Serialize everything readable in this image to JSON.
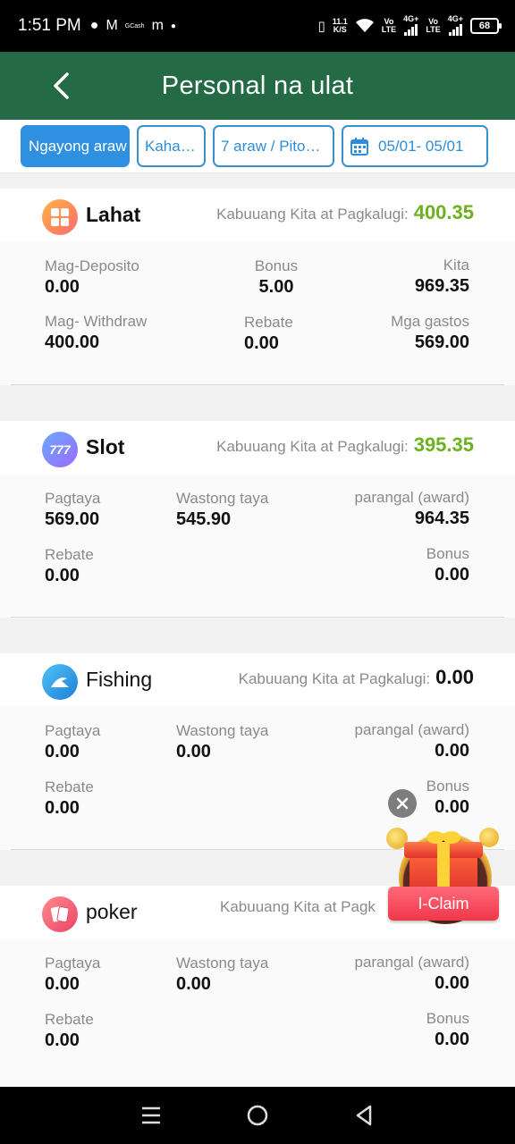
{
  "status_bar": {
    "time": "1:51 PM",
    "gcash_label": "GCash",
    "net_speed_value": "11.1",
    "net_speed_unit": "K/S",
    "volte1_top": "Vo",
    "volte1_bottom": "LTE",
    "net1": "4G+",
    "volte2_top": "Vo",
    "volte2_bottom": "LTE",
    "net2": "4G+",
    "battery": "68"
  },
  "header": {
    "title": "Personal na ulat"
  },
  "filters": {
    "today": "Ngayong araw",
    "yesterday": "Kaha…",
    "week": "7 araw / Pito…",
    "date_range": "05/01- 05/01"
  },
  "cards": {
    "all": {
      "name": "Lahat",
      "summary_label": "Kabuuang Kita at Pagkalugi:",
      "summary_value": "400.35",
      "deposit_label": "Mag-Deposito",
      "deposit_value": "0.00",
      "bonus_label": "Bonus",
      "bonus_value": "5.00",
      "income_label": "Kita",
      "income_value": "969.35",
      "withdraw_label": "Mag- Withdraw",
      "withdraw_value": "400.00",
      "rebate_label": "Rebate",
      "rebate_value": "0.00",
      "expenses_label": "Mga gastos",
      "expenses_value": "569.00"
    },
    "slot": {
      "name": "Slot",
      "summary_label": "Kabuuang Kita at Pagkalugi:",
      "summary_value": "395.35",
      "bet_label": "Pagtaya",
      "bet_value": "569.00",
      "valid_label": "Wastong taya",
      "valid_value": "545.90",
      "award_label": "parangal (award)",
      "award_value": "964.35",
      "rebate_label": "Rebate",
      "rebate_value": "0.00",
      "bonus_label": "Bonus",
      "bonus_value": "0.00"
    },
    "fishing": {
      "name": "Fishing",
      "summary_label": "Kabuuang Kita at Pagkalugi:",
      "summary_value": "0.00",
      "bet_label": "Pagtaya",
      "bet_value": "0.00",
      "valid_label": "Wastong taya",
      "valid_value": "0.00",
      "award_label": "parangal (award)",
      "award_value": "0.00",
      "rebate_label": "Rebate",
      "rebate_value": "0.00",
      "bonus_label": "Bonus",
      "bonus_value": "0.00"
    },
    "poker": {
      "name": "poker",
      "summary_label": "Kabuuang Kita at Pagk",
      "bet_label": "Pagtaya",
      "bet_value": "0.00",
      "valid_label": "Wastong taya",
      "valid_value": "0.00",
      "award_label": "parangal (award)",
      "award_value": "0.00",
      "rebate_label": "Rebate",
      "rebate_value": "0.00",
      "bonus_label": "Bonus",
      "bonus_value": "0.00"
    }
  },
  "promo": {
    "claim_label": "I-Claim"
  },
  "colors": {
    "header_bg": "#236a45",
    "accent_blue": "#2f8fe0",
    "profit_green": "#6cb21e",
    "claim_red": "#f0364a"
  }
}
